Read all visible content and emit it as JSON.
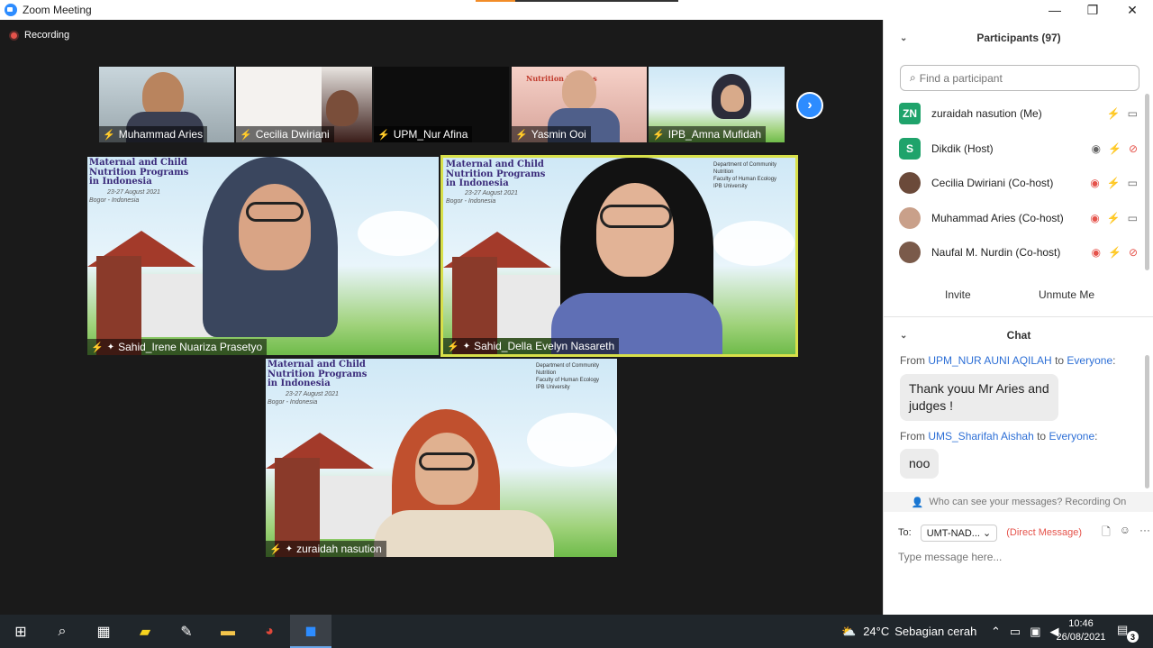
{
  "window": {
    "title": "Zoom Meeting",
    "minimize": "—",
    "restore": "❐",
    "close": "✕"
  },
  "meeting": {
    "recording_label": "Recording",
    "thumbnails": [
      {
        "name": "Muhammad Aries"
      },
      {
        "name": "Cecilia Dwiriani"
      },
      {
        "name": "UPM_Nur Afina"
      },
      {
        "name": "Yasmin Ooi"
      },
      {
        "name": "IPB_Amna Mufidah"
      }
    ],
    "main_tiles": [
      {
        "name": "Sahid_Irene Nuariza Prasetyo"
      },
      {
        "name": "Sahid_Della Evelyn Nasareth"
      },
      {
        "name": "zuraidah nasution"
      }
    ],
    "banner": {
      "title": "Maternal and Child Nutrition Programs in Indonesia",
      "dates": "23-27 August 2021",
      "place": "Bogor - Indonesia",
      "dept": "Department of Community Nutrition",
      "faculty": "Faculty of Human Ecology",
      "univ": "IPB University"
    },
    "thumb_banner": "Nutrition Months",
    "next_icon": "›"
  },
  "participants": {
    "header": "Participants (97)",
    "collapse_icon": "⌄",
    "search_placeholder": "Find a participant",
    "list": [
      {
        "initials": "ZN",
        "name": "zuraidah nasution (Me)",
        "color": "#1fa36b"
      },
      {
        "initials": "S",
        "name": "Dikdik (Host)",
        "color": "#1fa36b"
      },
      {
        "initials": "",
        "name": "Cecilia Dwiriani (Co-host)",
        "color": "#6b4a3a"
      },
      {
        "initials": "",
        "name": "Muhammad Aries (Co-host)",
        "color": "#c9a08a"
      },
      {
        "initials": "",
        "name": "Naufal M. Nurdin (Co-host)",
        "color": "#7a5a4a"
      }
    ],
    "invite_label": "Invite",
    "unmute_label": "Unmute Me"
  },
  "chat": {
    "header": "Chat",
    "messages": [
      {
        "from": "UPM_NUR AUNI AQILAH",
        "to": "Everyone",
        "text_line1": "Thank youu Mr Aries and",
        "text_line2": "judges !"
      },
      {
        "from": "UMS_Sharifah Aishah",
        "to": "Everyone",
        "text_line1": "noo"
      }
    ],
    "from_word": "From",
    "to_word": "to",
    "who_can_see": "Who can see your messages? Recording On",
    "to_label": "To:",
    "recipient": "UMT-NAD...",
    "direct_message": "(Direct Message)",
    "input_placeholder": "Type message here..."
  },
  "taskbar": {
    "weather_temp": "24°C",
    "weather_desc": "Sebagian cerah",
    "time": "10:46",
    "date": "26/08/2021",
    "notifications": "3"
  }
}
